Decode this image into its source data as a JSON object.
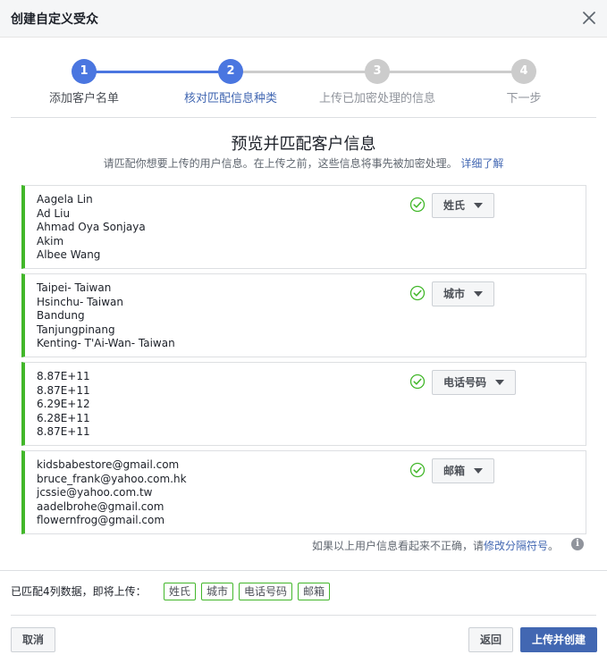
{
  "dialog": {
    "title": "创建自定义受众"
  },
  "colors": {
    "accent": "#4267b2",
    "step_active": "#4a76e0",
    "step_inactive": "#cccccc",
    "match_green": "#42b72a"
  },
  "steps": [
    {
      "number": "1",
      "label": "添加客户名单",
      "state": "done"
    },
    {
      "number": "2",
      "label": "核对匹配信息种类",
      "state": "current"
    },
    {
      "number": "3",
      "label": "上传已加密处理的信息",
      "state": "pending"
    },
    {
      "number": "4",
      "label": "下一步",
      "state": "pending"
    }
  ],
  "preview": {
    "title": "预览并匹配客户信息",
    "subtitle": "请匹配你想要上传的用户信息。在上传之前，这些信息将事先被加密处理。",
    "learn_more": "详细了解"
  },
  "columns": [
    {
      "values": [
        "Aagela Lin",
        "Ad Liu",
        "Ahmad Oya Sonjaya",
        "Akim",
        "Albee Wang"
      ],
      "match_type": "姓氏",
      "status": "check-circle-icon"
    },
    {
      "values": [
        "Taipei- Taiwan",
        "Hsinchu- Taiwan",
        "Bandung",
        "Tanjungpinang",
        "Kenting- T'Ai-Wan- Taiwan"
      ],
      "match_type": "城市",
      "status": "check-circle-icon"
    },
    {
      "values": [
        "8.87E+11",
        "8.87E+11",
        "6.29E+12",
        "6.28E+11",
        "8.87E+11"
      ],
      "match_type": "电话号码",
      "status": "check-circle-icon"
    },
    {
      "values": [
        "kidsbabestore@gmail.com",
        "bruce_frank@yahoo.com.hk",
        "jcssie@yahoo.com.tw",
        "aadelbrohe@gmail.com",
        "flowernfrog@gmail.com"
      ],
      "match_type": "邮箱",
      "status": "check-circle-icon"
    }
  ],
  "note": {
    "text": "如果以上用户信息看起来不正确，请",
    "link": "修改分隔符号",
    "end": "。",
    "info_icon": "i"
  },
  "summary": {
    "text": "已匹配4列数据，即将上传：",
    "tags": [
      "姓氏",
      "城市",
      "电话号码",
      "邮箱"
    ]
  },
  "buttons": {
    "cancel": "取消",
    "back": "返回",
    "upload": "上传并创建"
  }
}
